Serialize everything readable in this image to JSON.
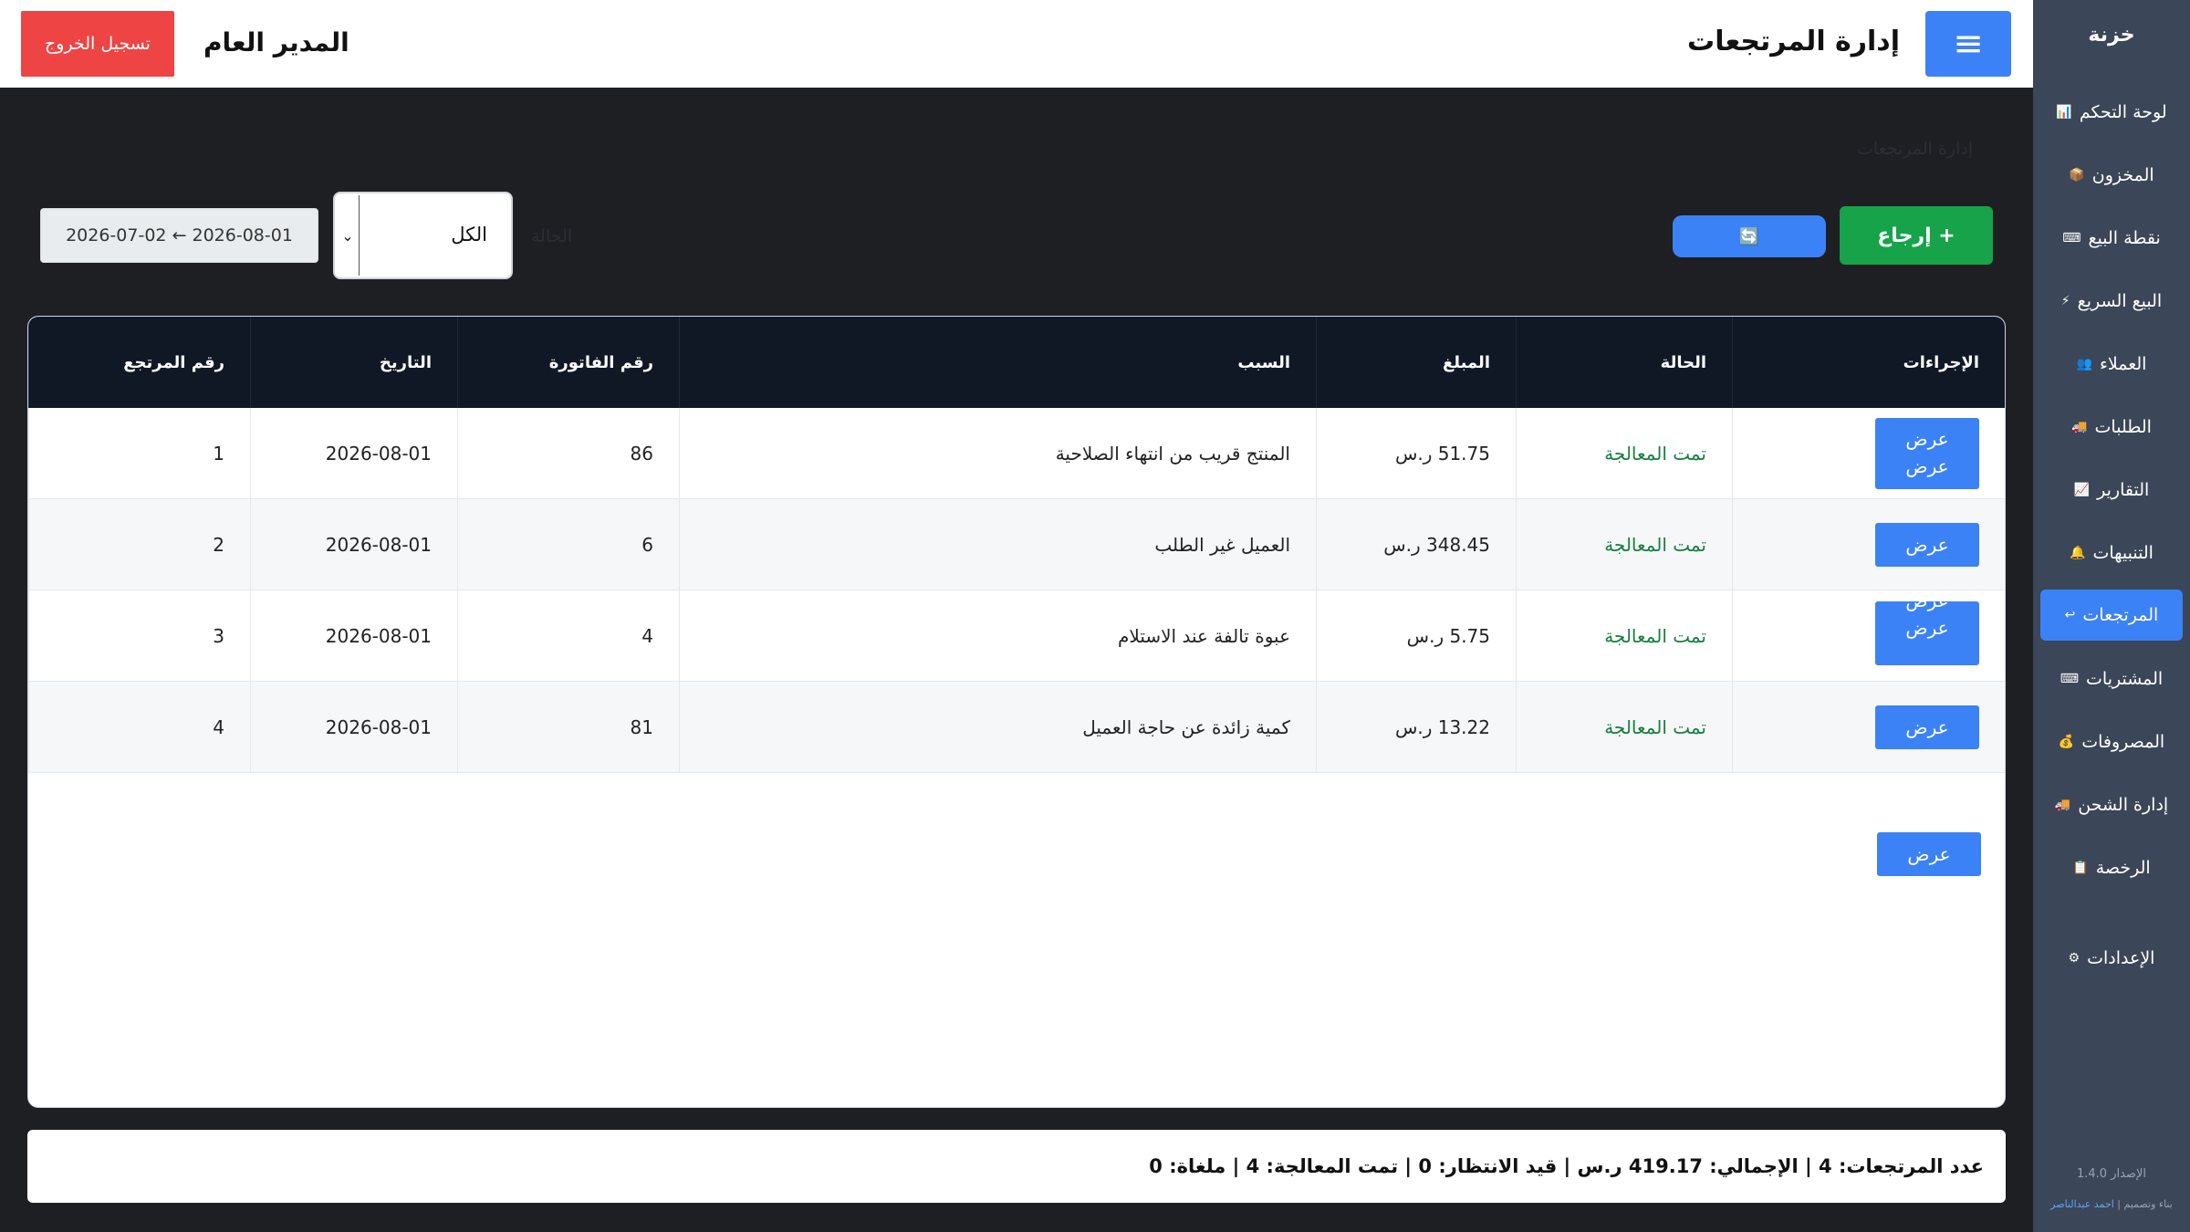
{
  "sidebar": {
    "brand": "خزنة",
    "items": [
      {
        "label": "لوحة التحكم",
        "icon": "📊",
        "icon_name": "chart-icon"
      },
      {
        "label": "المخزون",
        "icon": "📦",
        "icon_name": "box-icon"
      },
      {
        "label": "نقطة البيع",
        "icon": "⌨",
        "icon_name": "keyboard-icon"
      },
      {
        "label": "البيع السريع",
        "icon": "⚡",
        "icon_name": "lightning-icon"
      },
      {
        "label": "العملاء",
        "icon": "👥",
        "icon_name": "users-icon"
      },
      {
        "label": "الطلبات",
        "icon": "🚚",
        "icon_name": "truck-icon"
      },
      {
        "label": "التقارير",
        "icon": "📈",
        "icon_name": "trend-icon"
      },
      {
        "label": "التنبيهات",
        "icon": "🔔",
        "icon_name": "bell-icon"
      },
      {
        "label": "المرتجعات",
        "icon": "↩",
        "icon_name": "return-icon",
        "active": true
      },
      {
        "label": "المشتريات",
        "icon": "⌨",
        "icon_name": "keyboard-icon"
      },
      {
        "label": "المصروفات",
        "icon": "💰",
        "icon_name": "money-bag-icon"
      },
      {
        "label": "إدارة الشحن",
        "icon": "🚚",
        "icon_name": "truck-icon"
      },
      {
        "label": "الرخصة",
        "icon": "📋",
        "icon_name": "clipboard-icon"
      },
      {
        "label": "الإعدادات",
        "icon": "⚙",
        "icon_name": "gear-icon"
      }
    ],
    "version": "الإصدار 1.4.0",
    "credit_prefix": "بناء وتصميم |",
    "credit_name": "احمد عبدالناصر"
  },
  "header": {
    "title": "إدارة المرتجعات",
    "menu_icon": "≡",
    "user_name": "المدير العام",
    "logout_label": "تسجيل الخروج"
  },
  "breadcrumb": "إدارة المرتجعات",
  "toolbar": {
    "add_label": "+ إرجاع",
    "refresh_icon": "🔄",
    "filter_label": "الحالة",
    "status_value": "الكل",
    "date_range": "2026-07-02 ← 2026-08-01"
  },
  "table": {
    "headers": [
      "رقم المرتجع",
      "التاريخ",
      "رقم الفاتورة",
      "السبب",
      "المبلغ",
      "الحالة",
      "الإجراءات"
    ],
    "rows": [
      {
        "id": "1",
        "date": "2026-08-01",
        "invoice": "86",
        "reason": "المنتج قريب من انتهاء الصلاحية",
        "amount": "51.75 ر.س",
        "status": "تمت المعالجة",
        "action": "عرض",
        "action2": "عرض"
      },
      {
        "id": "2",
        "date": "2026-08-01",
        "invoice": "6",
        "reason": "العميل غير الطلب",
        "amount": "348.45 ر.س",
        "status": "تمت المعالجة",
        "action": "عرض"
      },
      {
        "id": "3",
        "date": "2026-08-01",
        "invoice": "4",
        "reason": "عبوة تالفة عند الاستلام",
        "amount": "5.75 ر.س",
        "status": "تمت المعالجة",
        "action": "عرض",
        "action2": "عرض"
      },
      {
        "id": "4",
        "date": "2026-08-01",
        "invoice": "81",
        "reason": "كمية زائدة عن حاجة العميل",
        "amount": "13.22 ر.س",
        "status": "تمت المعالجة",
        "action": "عرض"
      }
    ],
    "extra_action": "عرض"
  },
  "summary": "عدد المرتجعات: 4 | الإجمالي: 419.17 ر.س | قيد الانتظار: 0 | تمت المعالجة: 4 | ملغاة: 0"
}
